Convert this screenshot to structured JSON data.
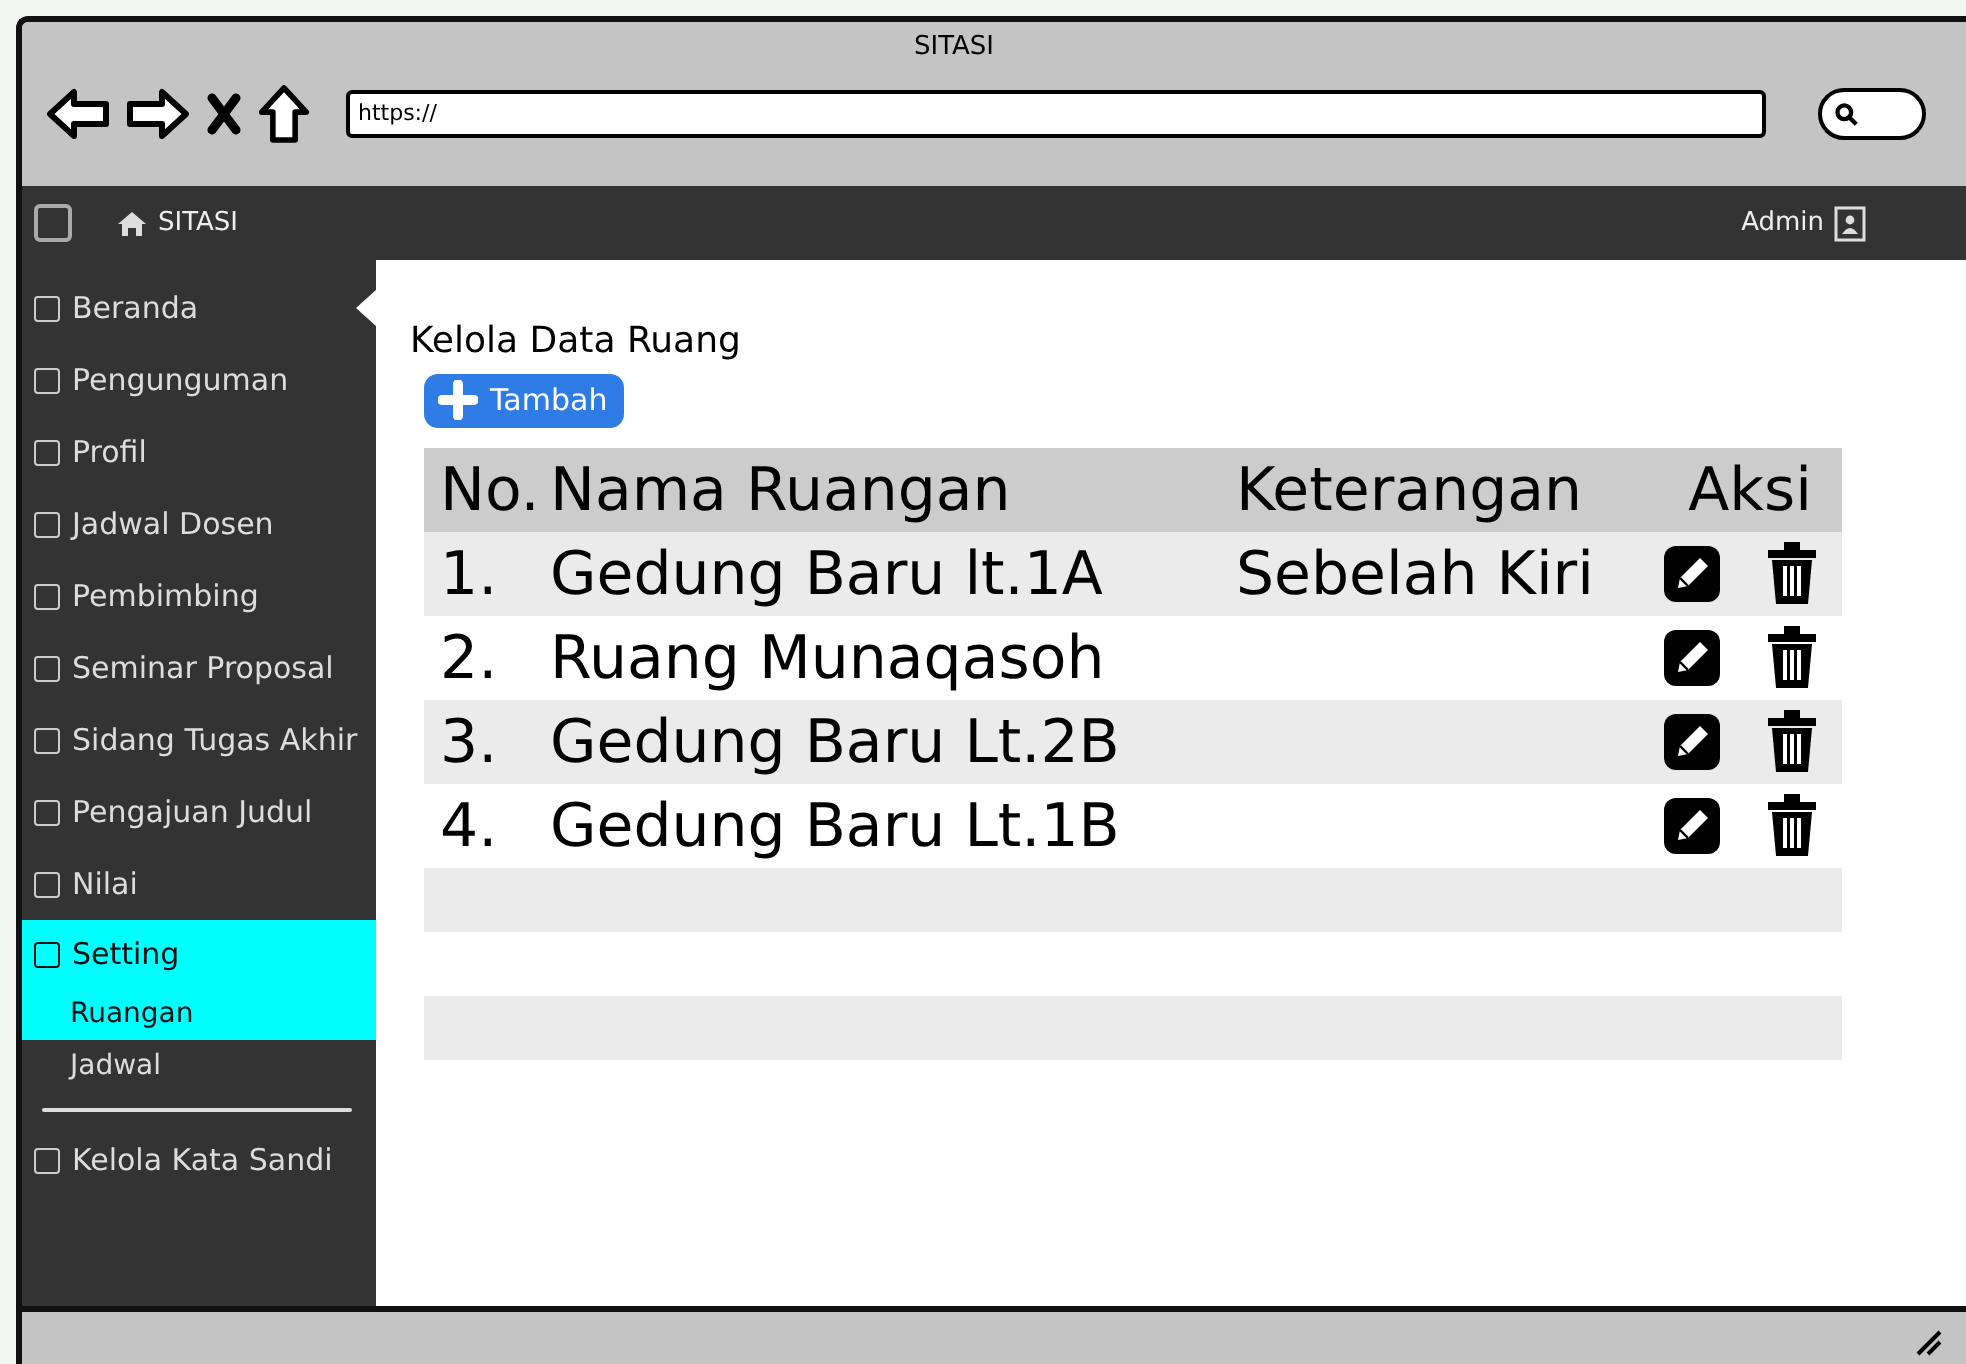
{
  "window": {
    "title": "SITASI"
  },
  "browser": {
    "url": "https://"
  },
  "navbar": {
    "brand": "SITASI",
    "user": "Admin"
  },
  "sidebar": {
    "items": [
      {
        "label": "Beranda",
        "selected": false,
        "current": true
      },
      {
        "label": "Pengunguman",
        "selected": false,
        "current": false
      },
      {
        "label": "Profil",
        "selected": false,
        "current": false
      },
      {
        "label": "Jadwal Dosen",
        "selected": false,
        "current": false
      },
      {
        "label": "Pembimbing",
        "selected": false,
        "current": false
      },
      {
        "label": "Seminar Proposal",
        "selected": false,
        "current": false
      },
      {
        "label": "Sidang Tugas Akhir",
        "selected": false,
        "current": false
      },
      {
        "label": "Pengajuan Judul",
        "selected": false,
        "current": false
      },
      {
        "label": "Nilai",
        "selected": false,
        "current": false
      },
      {
        "label": "Setting",
        "selected": true,
        "current": false,
        "expanded": true,
        "children": [
          {
            "label": "Ruangan",
            "selected": true
          },
          {
            "label": "Jadwal",
            "selected": false
          }
        ]
      },
      {
        "label": "Kelola Kata Sandi",
        "selected": false,
        "current": false
      }
    ]
  },
  "content": {
    "title": "Kelola Data Ruang",
    "add_button": "Tambah",
    "table": {
      "columns": [
        "No.",
        "Nama Ruangan",
        "Keterangan",
        "Aksi"
      ],
      "rows": [
        {
          "no": "1.",
          "name": "Gedung Baru lt.1A",
          "note": "Sebelah Kiri"
        },
        {
          "no": "2.",
          "name": "Ruang Munaqasoh"
        },
        {
          "no": "3.",
          "name": "Gedung Baru Lt.2B"
        },
        {
          "no": "4.",
          "name": "Gedung Baru Lt.1B"
        }
      ]
    }
  }
}
